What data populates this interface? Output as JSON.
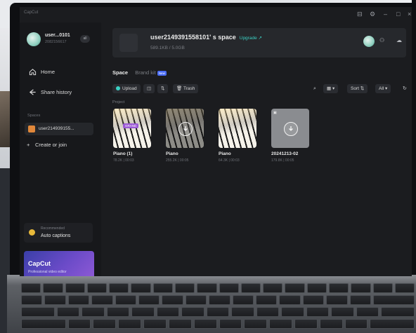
{
  "window": {
    "app_name": "CapCut",
    "controls": [
      "⊟",
      "⚙",
      "–",
      "□",
      "×"
    ]
  },
  "profile": {
    "name": "user...0101",
    "id": "2082156617",
    "badge": "all"
  },
  "sidebar": {
    "nav": [
      {
        "label": "Home",
        "icon": "home-icon"
      },
      {
        "label": "Share history",
        "icon": "share-icon"
      }
    ],
    "spaces_label": "Spaces",
    "space_item": "user214939155...",
    "create_label": "Create or join",
    "recommended": {
      "small": "Recommended",
      "main": "Auto captions"
    },
    "promo": {
      "title": "CapCut",
      "subtitle": "Professional video editor"
    }
  },
  "header": {
    "title": "user2149391558101' s space",
    "upgrade": "Upgrade ↗",
    "storage": "589.1KB / 5.0GB"
  },
  "tabs": {
    "space": "Space",
    "brand": "Brand kit",
    "new_badge": "New"
  },
  "toolbar": {
    "upload": "Upload",
    "trash": "Trash",
    "sort": "Sort ⇅",
    "filter": "All ▾"
  },
  "project_label": "Project",
  "projects": [
    {
      "name": "Piano (1)",
      "meta": "78.2K | 00:03",
      "tag": "GRAND"
    },
    {
      "name": "Piano",
      "meta": "255.2K | 00:05"
    },
    {
      "name": "Piano",
      "meta": "64.3K | 00:03"
    },
    {
      "name": "20241213-02",
      "meta": "179.8K | 00:05"
    }
  ],
  "colors": {
    "accent": "#3bd1c4",
    "space_square": "#e0873a",
    "promo": "#6b4bc8"
  }
}
